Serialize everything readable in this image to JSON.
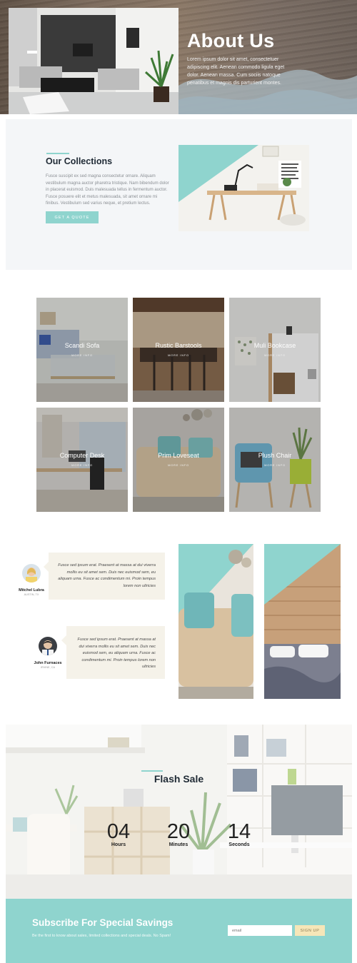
{
  "hero": {
    "title": "About Us",
    "text": "Lorem ipsum dolor sit amet, consectetuer adipiscing elit. Aenean commodo ligula eget dolor. Aenean massa. Cum sociis natoque penatibus et magnis dis parturient montes."
  },
  "collections": {
    "title": "Our Collections",
    "text": "Fusce suscipit ex sed magna consectetur ornare. Aliquam vestibulum magna auctor pharetra tristique. Nam bibendum dolor in placerat euismod. Duis malesuada tellus in fermentum auctor. Fusce posuere elit et metus malesuada, sit amet ornare mi finibus. Vestibulum sed varius neque, et pretium lectus.",
    "button": "GET A QUOTE"
  },
  "products": [
    {
      "name": "Scandi Sofa",
      "more": "MORE INFO"
    },
    {
      "name": "Rustic Barstools",
      "more": "MORE INFO"
    },
    {
      "name": "Muli Bookcase",
      "more": "MORE INFO"
    },
    {
      "name": "Computer Desk",
      "more": "MORE INFO"
    },
    {
      "name": "Prim Loveseat",
      "more": "MORE INFO"
    },
    {
      "name": "Plush Chair",
      "more": "MORE INFO"
    }
  ],
  "testimonials": [
    {
      "name": "Mitchel Lubra",
      "location": "AUSTIN, TX",
      "quote": "Fusce sed ipsum erat. Praesent at massa at dui viverra mollis eu sit amet sem. Duis nec euismod sem, eu aliquam urna. Fusce ac condimentum mi. Proin tempus lorem non ultricies"
    },
    {
      "name": "John Furnaces",
      "location": "IRVINE, CA",
      "quote": "Fusce sed ipsum erat. Praesent at massa at dui viverra mollis eu sit amet sem. Duis nec euismod sem, eu aliquam urna. Fusce ac condimentum mi. Proin tempus lorem non ultricies"
    }
  ],
  "sale": {
    "title": "Flash Sale",
    "countdown": [
      {
        "value": "04",
        "label": "Hours"
      },
      {
        "value": "20",
        "label": "Minutes"
      },
      {
        "value": "14",
        "label": "Seconds"
      }
    ]
  },
  "subscribe": {
    "title": "Subscribe For Special Savings",
    "text": "Be the first to know about sales, limited collections and special deals. No Spam!",
    "email_placeholder": "email",
    "button": "SIGN UP"
  },
  "colors": {
    "accent": "#8fd4ce",
    "heading": "#1f2a35",
    "sign_up": "#f6e6b8"
  }
}
